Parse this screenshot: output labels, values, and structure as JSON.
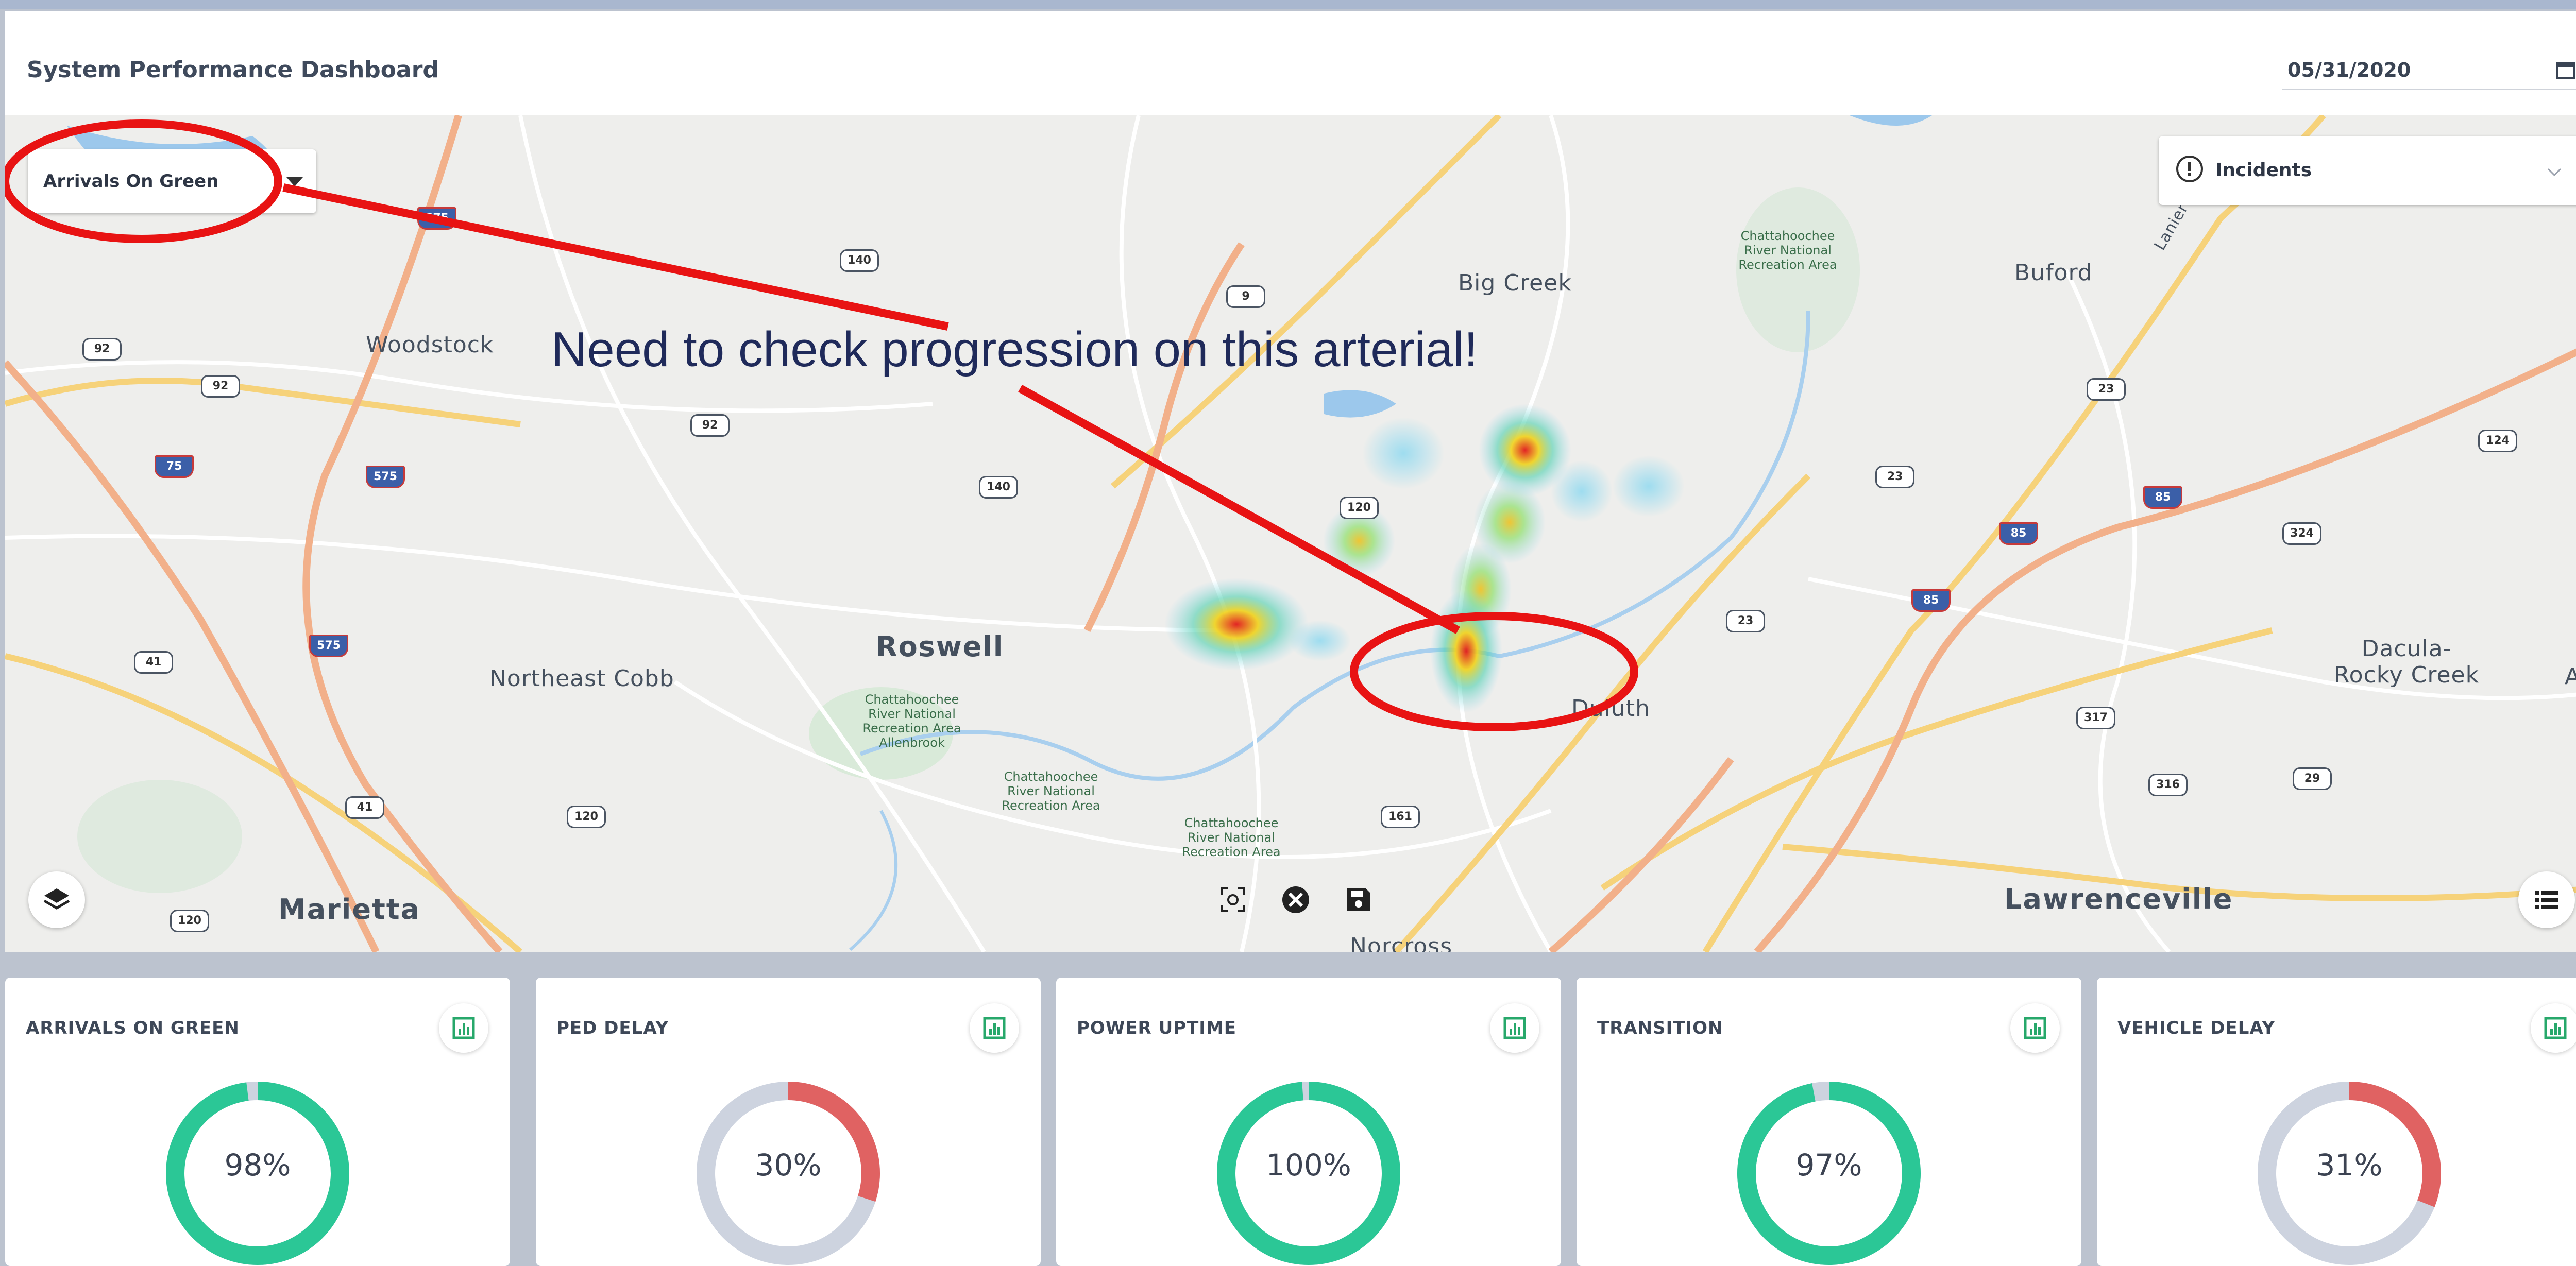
{
  "header": {
    "title": "System Performance Dashboard",
    "date": "05/31/2020"
  },
  "map": {
    "metric_select": {
      "value": "Arrivals On Green"
    },
    "overlay_select": {
      "value": "Incidents"
    },
    "places": {
      "woodstock": "Woodstock",
      "big_creek": "Big Creek",
      "buford": "Buford",
      "roswell": "Roswell",
      "northeast_cobb": "Northeast Cobb",
      "duluth": "Duluth",
      "dacula": "Dacula-\nRocky Creek",
      "aub": "Aub",
      "marietta": "Marietta",
      "lawrenceville": "Lawrenceville",
      "norcross": "Norcross",
      "chatt_1": "Chattahoochee River National Recreation Area",
      "chatt_2": "Chattahoochee River National Recreation Area Allenbrook",
      "chatt_3": "Chattahoochee River National Recreation Area",
      "chatt_4": "Chattahoochee River National Recreation Area",
      "lanier": "Lanier I"
    },
    "shields": [
      "575",
      "140",
      "9",
      "92",
      "92",
      "92",
      "75",
      "575",
      "575",
      "41",
      "41",
      "120",
      "120",
      "140",
      "120",
      "23",
      "23",
      "85",
      "85",
      "85",
      "124",
      "324",
      "317",
      "316",
      "29",
      "23",
      "161"
    ],
    "annotation": "Need to check progression on this arterial!"
  },
  "metrics": [
    {
      "name": "ARRIVALS ON GREEN",
      "percent": 98,
      "label": "98%",
      "color": "#2bc796"
    },
    {
      "name": "PED DELAY",
      "percent": 30,
      "label": "30%",
      "color": "#e06262"
    },
    {
      "name": "POWER UPTIME",
      "percent": 100,
      "label": "100%",
      "color": "#2bc796"
    },
    {
      "name": "TRANSITION",
      "percent": 97,
      "label": "97%",
      "color": "#2bc796"
    },
    {
      "name": "VEHICLE DELAY",
      "percent": 31,
      "label": "31%",
      "color": "#e06262"
    }
  ],
  "colors": {
    "ring_track": "#cdd3df",
    "chart_icon": "#27a86b"
  },
  "icons": [
    "calendar-icon",
    "alert-icon",
    "chevron-down-icon",
    "layers-icon",
    "screenshot-icon",
    "clear-icon",
    "save-icon",
    "list-icon",
    "chart-icon"
  ]
}
